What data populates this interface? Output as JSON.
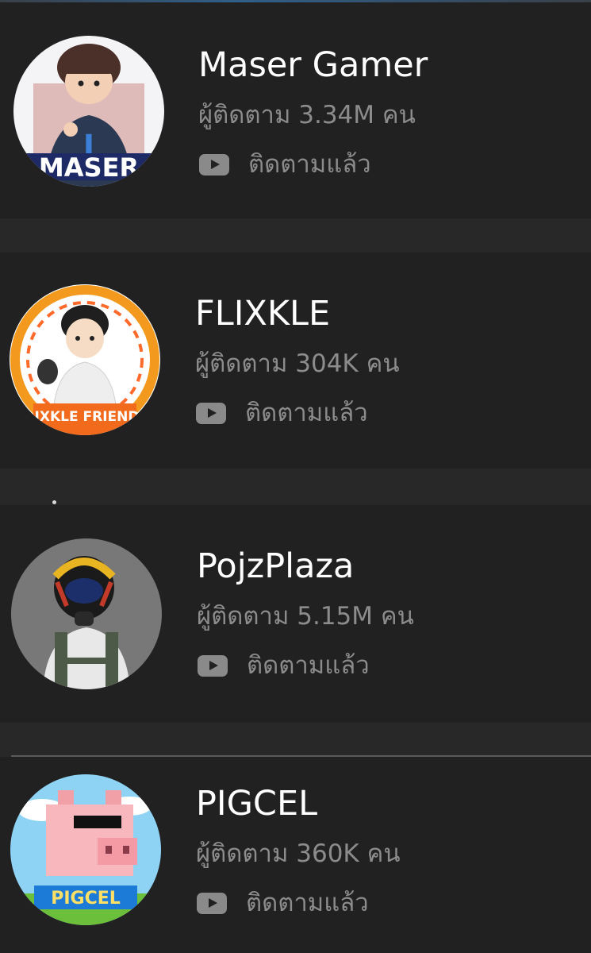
{
  "channels": [
    {
      "name": "Maser Gamer",
      "subscribers": "ผู้ติดตาม 3.34M คน",
      "status": "ติดตามแล้ว",
      "avatar_icon": "avatar-maser-gamer",
      "avatar_text": "MASER"
    },
    {
      "name": "FLIXKLE",
      "subscribers": "ผู้ติดตาม 304K คน",
      "status": "ติดตามแล้ว",
      "avatar_icon": "avatar-flixkle",
      "avatar_text": "FLIXKLE FRIEND'S"
    },
    {
      "name": "PojzPlaza",
      "subscribers": "ผู้ติดตาม 5.15M คน",
      "status": "ติดตามแล้ว",
      "avatar_icon": "avatar-pojzplaza"
    },
    {
      "name": "PIGCEL",
      "subscribers": "ผู้ติดตาม 360K คน",
      "status": "ติดตามแล้ว",
      "avatar_icon": "avatar-pigcel",
      "avatar_text": "PIGCEL"
    }
  ],
  "status_icon": "youtube-play-icon",
  "colors": {
    "background": "#282828",
    "card": "#212121",
    "name_text": "#ffffff",
    "secondary_text": "#8c8c8c",
    "icon": "#8a8a8a"
  }
}
